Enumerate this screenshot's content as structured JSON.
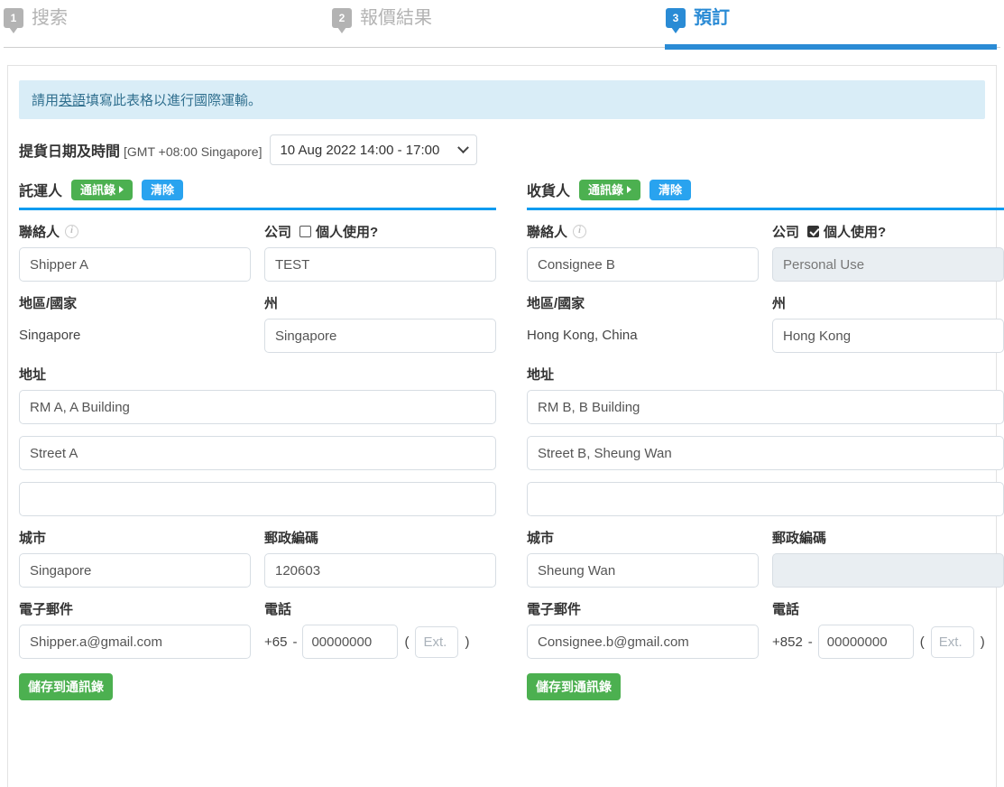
{
  "steps": [
    {
      "num": "1",
      "label": "搜索",
      "active": false
    },
    {
      "num": "2",
      "label": "報價結果",
      "active": false
    },
    {
      "num": "3",
      "label": "預訂",
      "active": true
    }
  ],
  "notice": {
    "before": "請用",
    "link": "英語",
    "after": "填寫此表格以進行國際運輸。"
  },
  "pickup": {
    "label": "提貨日期及時間",
    "timezone": "[GMT +08:00 Singapore]",
    "selected": "10 Aug 2022 14:00 - 17:00"
  },
  "buttons": {
    "address_book": "通訊錄",
    "clear": "清除",
    "save_to_address_book": "儲存到通訊錄"
  },
  "labels": {
    "contact": "聯絡人",
    "company": "公司",
    "personal_use": "個人使用?",
    "region_country": "地區/國家",
    "state": "州",
    "address": "地址",
    "city": "城市",
    "postal_code": "郵政編碼",
    "email": "電子郵件",
    "phone": "電話",
    "ext_placeholder": "Ext."
  },
  "shipper": {
    "title": "託運人",
    "personal_use_checked": false,
    "contact": "Shipper A",
    "company": "TEST",
    "company_disabled": false,
    "region_country": "Singapore",
    "state": "Singapore",
    "address1": "RM A, A Building",
    "address2": "Street A",
    "address3": "",
    "city": "Singapore",
    "postal_code": "120603",
    "postal_disabled": false,
    "email": "Shipper.a@gmail.com",
    "phone_cc": "+65",
    "phone_number": "00000000",
    "phone_ext": ""
  },
  "consignee": {
    "title": "收貨人",
    "personal_use_checked": true,
    "contact": "Consignee B",
    "company": "Personal Use",
    "company_disabled": true,
    "region_country": "Hong Kong, China",
    "state": "Hong Kong",
    "address1": "RM B, B Building",
    "address2": "Street B, Sheung Wan",
    "address3": "",
    "city": "Sheung Wan",
    "postal_code": "",
    "postal_disabled": true,
    "email": "Consignee.b@gmail.com",
    "phone_cc": "+852",
    "phone_number": "00000000",
    "phone_ext": ""
  },
  "colors": {
    "accent_blue": "#2a8bd5",
    "rule_blue": "#0b9bf0",
    "green": "#4cb050",
    "light_blue_btn": "#29a3ef",
    "notice_bg": "#d9edf7",
    "notice_text": "#31708f",
    "inactive_grey": "#b3b3b3"
  }
}
